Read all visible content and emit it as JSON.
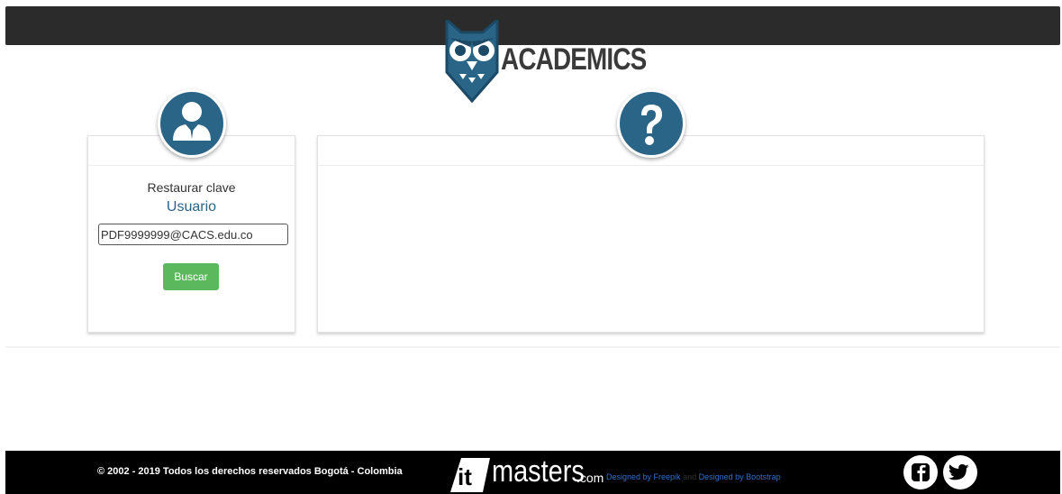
{
  "brand": {
    "name": "ACADEMICS"
  },
  "login": {
    "title": "Restaurar clave",
    "subtitle": "Usuario",
    "user_value": "PDF9999999@CACS.edu.co",
    "search_label": "Buscar"
  },
  "footer": {
    "copyright": "© 2002 - 2019 Todos los derechos reservados Bogotá - Colombia",
    "logo_masters": "masters",
    "logo_com": ".com",
    "credit_freepik": "Designed by Freepik",
    "credit_and": "and",
    "credit_bootstrap": "Designed by Bootstrap"
  },
  "colors": {
    "accent": "#2a6588",
    "success": "#5cb85c",
    "bar": "#2b2b2b"
  },
  "icons": [
    "owl-logo-icon",
    "user-icon",
    "question-icon",
    "facebook-icon",
    "twitter-icon"
  ]
}
